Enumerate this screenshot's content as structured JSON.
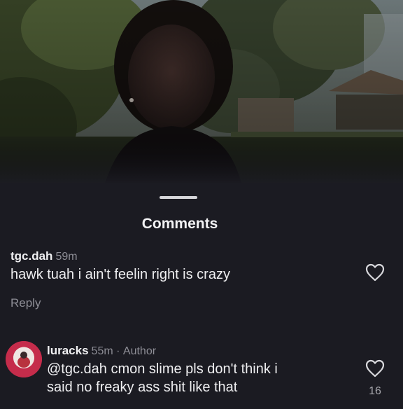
{
  "sheet": {
    "title": "Comments"
  },
  "comments": [
    {
      "username": "tgc.dah",
      "time": "59m",
      "text": "hawk tuah i ain't feelin right is crazy",
      "reply_label": "Reply",
      "icons": {
        "like": "heart-outline-icon"
      }
    },
    {
      "username": "luracks",
      "time": "55m",
      "separator": "·",
      "author_label": "Author",
      "text_line1": "@tgc.dah cmon slime pls don't think i",
      "text_line2": "said no freaky ass shit like that",
      "likes": "16",
      "icons": {
        "like": "heart-outline-icon",
        "avatar": "profile-avatar"
      }
    }
  ],
  "colors": {
    "sheet_background": "#1b1b22",
    "text_primary": "#eeeef0",
    "text_secondary": "#8e8e96",
    "avatar_ring": "#c52c4b"
  }
}
